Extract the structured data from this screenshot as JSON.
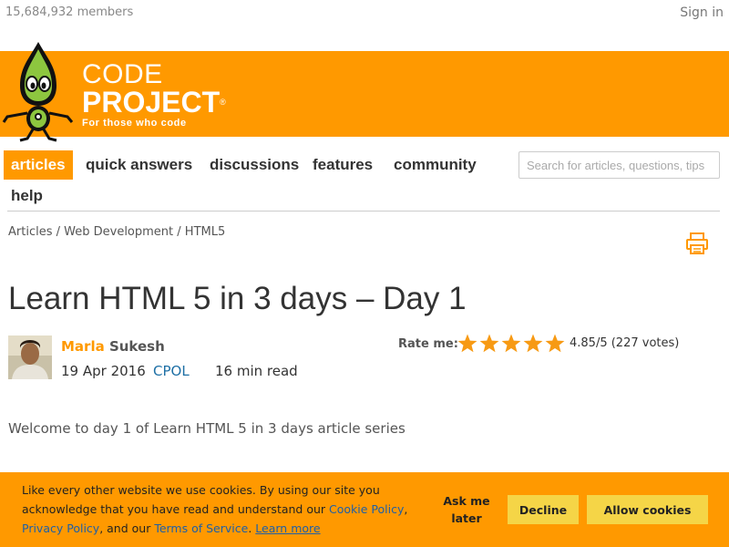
{
  "header": {
    "members": "15,684,932 members",
    "sign_in": "Sign in"
  },
  "logo": {
    "line1": "CODE",
    "line2": "PROJECT",
    "registered": "®",
    "tagline": "For those who code"
  },
  "nav": {
    "items": [
      {
        "label": "articles",
        "active": true
      },
      {
        "label": "quick answers",
        "active": false
      },
      {
        "label": "discussions",
        "active": false
      },
      {
        "label": "features",
        "active": false
      },
      {
        "label": "community",
        "active": false
      },
      {
        "label": "help",
        "active": false
      }
    ],
    "search_placeholder": "Search for articles, questions, tips"
  },
  "breadcrumb": {
    "items": [
      "Articles",
      "Web Development",
      "HTML5"
    ],
    "separator": " / "
  },
  "icons": {
    "print": "print-icon",
    "star": "star-icon"
  },
  "article": {
    "title": "Learn HTML 5 in 3 days – Day 1",
    "author_first": "Marla",
    "author_last": "Sukesh",
    "date": "19 Apr 2016",
    "license": "CPOL",
    "read_time": "16 min read",
    "rate_label": "Rate me:",
    "rating_stars": 5,
    "rating_text": "4.85/5 (227 votes)",
    "intro": "Welcome to day 1 of Learn HTML 5 in 3 days article series"
  },
  "cookie_banner": {
    "text_part1": "Like every other website we use cookies. By using our site you acknowledge that you have read and understand our ",
    "cookie_policy": "Cookie Policy",
    "comma": ", ",
    "privacy_policy": "Privacy Policy",
    "text_part2": ", and our ",
    "terms": "Terms of Service",
    "period": ".",
    "learn_more": "Learn more",
    "ask_me_later": "Ask me later",
    "decline": "Decline",
    "allow": "Allow cookies"
  },
  "colors": {
    "brand_orange": "#ff9900",
    "button_yellow": "#f5d547",
    "link_blue": "#1d6fa5",
    "star_orange": "#f79a14"
  }
}
